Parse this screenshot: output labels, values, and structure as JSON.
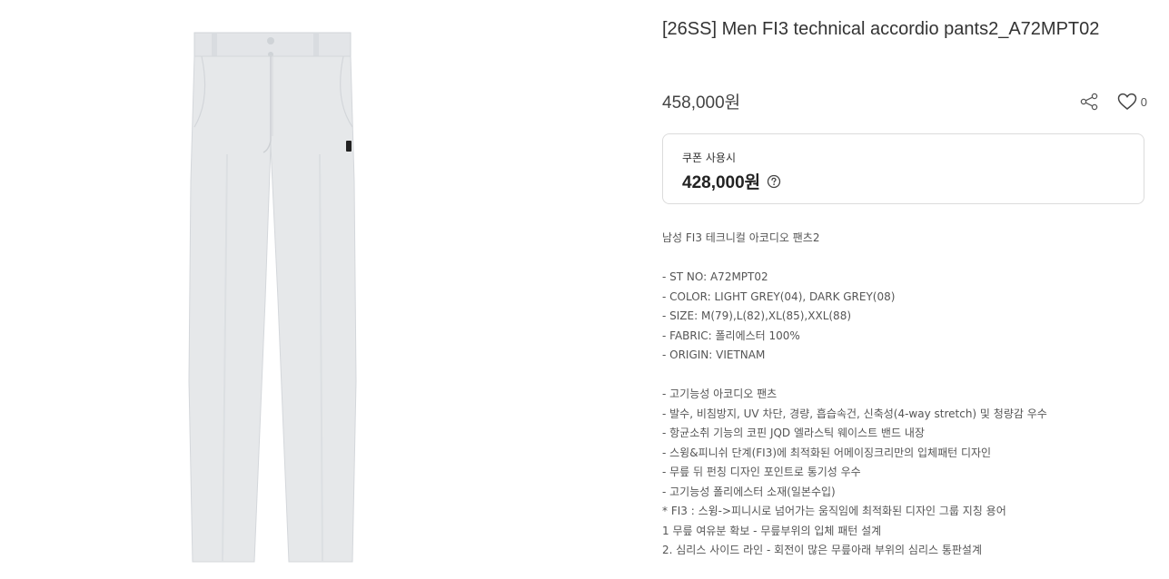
{
  "product": {
    "title": "[26SS] Men FI3 technical accordio pants2_A72MPT02",
    "price": "458,000원",
    "like_count": "0",
    "colors": {
      "pants": "#e6e8ea",
      "pants_shadow": "#d5d8db",
      "accent": "#222222"
    }
  },
  "coupon": {
    "label": "쿠폰 사용시",
    "price": "428,000원"
  },
  "icons": {
    "share": "share-icon",
    "like": "heart-icon",
    "help": "question-circle-icon"
  },
  "description": {
    "intro": "남성 FI3 테크니컬 아코디오 팬츠2",
    "specs": [
      "- ST NO: A72MPT02",
      "- COLOR: LIGHT GREY(04), DARK GREY(08)",
      "- SIZE: M(79),L(82),XL(85),XXL(88)",
      "- FABRIC: 폴리에스터 100%",
      "- ORIGIN: VIETNAM"
    ],
    "features": [
      "- 고기능성 아코디오 팬츠",
      "- 발수, 비침방지, UV 차단, 경량, 흡습속건, 신축성(4-way stretch) 및 청량감 우수",
      "- 항균소취 기능의 코핀 JQD 엘라스틱 웨이스트 밴드 내장",
      "- 스윙&피니쉬 단계(FI3)에 최적화된 어메이징크리만의 입체패턴 디자인",
      "- 무릎 뒤 펀칭 디자인 포인트로 통기성 우수",
      "- 고기능성 폴리에스터 소재(일본수입)",
      "* FI3 : 스윙->피니시로 넘어가는 움직임에 최적화된 디자인 그룹 지칭 용어",
      "1 무릎 여유분 확보 - 무릎부위의 입체 패턴 설계",
      "2. 심리스 사이드 라인 - 회전이 많은 무릎아래 부위의 심리스 통판설계"
    ]
  }
}
